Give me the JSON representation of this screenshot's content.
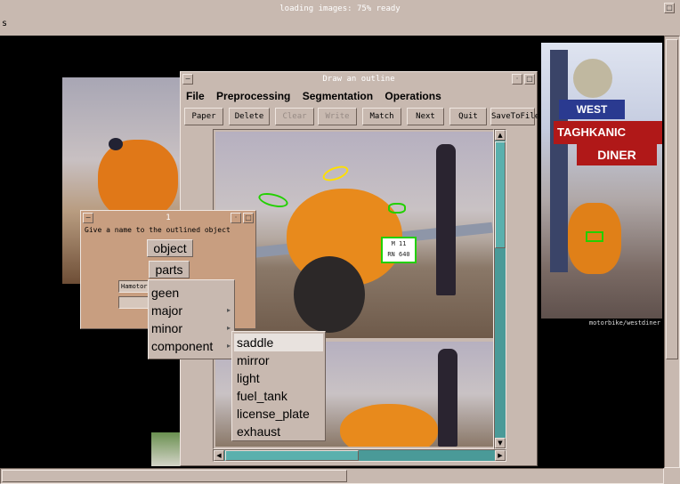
{
  "top_status": {
    "title": "loading images: 75% ready",
    "indicator": "s"
  },
  "main_window": {
    "title": "Draw an outline",
    "menu": [
      "File",
      "Preprocessing",
      "Segmentation",
      "Operations"
    ],
    "toolbar": [
      {
        "label": "Paper",
        "enabled": true
      },
      {
        "label": "Delete",
        "enabled": true
      },
      {
        "label": "Clear",
        "enabled": false
      },
      {
        "label": "Write",
        "enabled": false
      },
      {
        "label": "Match",
        "enabled": true
      },
      {
        "label": "Next",
        "enabled": true
      },
      {
        "label": "Quit",
        "enabled": true
      },
      {
        "label": "SaveToFile",
        "enabled": true
      }
    ]
  },
  "dialog": {
    "title": "1",
    "prompt": "Give a name to the outlined object",
    "buttons": [
      "object",
      "parts"
    ],
    "field_value": "Hamotor"
  },
  "parts_menu": [
    {
      "label": "geen",
      "submenu": false
    },
    {
      "label": "major",
      "submenu": true
    },
    {
      "label": "minor",
      "submenu": true
    },
    {
      "label": "component",
      "submenu": true
    }
  ],
  "component_menu": {
    "items": [
      "saddle",
      "mirror",
      "light",
      "fuel_tank",
      "license_plate",
      "exhaust"
    ],
    "highlighted": "saddle"
  },
  "right_photo": {
    "sign_top": "WEST",
    "sign_main": "TAGHKANIC",
    "sign_sub": "DINER",
    "caption": "motorbike/westdiner"
  },
  "plate_text": {
    "line1": "M 11",
    "line2": "RN 640"
  },
  "colors": {
    "chrome": "#c8b9b0",
    "outline_green": "#22d000",
    "outline_yellow": "#ffe000",
    "menu_highlight": "#e8e2de"
  }
}
